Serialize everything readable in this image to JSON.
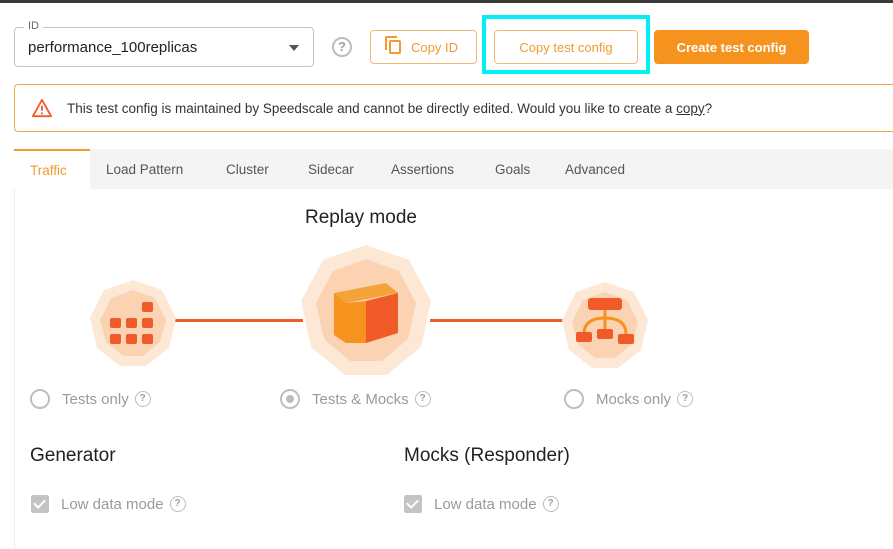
{
  "id_field": {
    "label": "ID",
    "value": "performance_100replicas"
  },
  "toolbar": {
    "copy_id_label": "Copy ID",
    "copy_test_config_label": "Copy test config",
    "create_test_config_label": "Create test config"
  },
  "alert": {
    "text": "This test config is maintained by Speedscale and cannot be directly edited. Would you like to create a ",
    "link": "copy",
    "suffix": "?"
  },
  "tabs": [
    "Traffic",
    "Load Pattern",
    "Cluster",
    "Sidecar",
    "Assertions",
    "Goals",
    "Advanced"
  ],
  "active_tab": "Traffic",
  "replay": {
    "title": "Replay mode",
    "options": [
      {
        "label": "Tests only",
        "selected": false
      },
      {
        "label": "Tests & Mocks",
        "selected": true
      },
      {
        "label": "Mocks only",
        "selected": false
      }
    ]
  },
  "generator": {
    "title": "Generator",
    "low_data_mode": "Low data mode",
    "checked": true
  },
  "responder": {
    "title": "Mocks (Responder)",
    "low_data_mode": "Low data mode",
    "checked": true
  },
  "colors": {
    "accent": "#f6921e",
    "line": "#ef5b2b",
    "highlight": "#00f0f5"
  }
}
